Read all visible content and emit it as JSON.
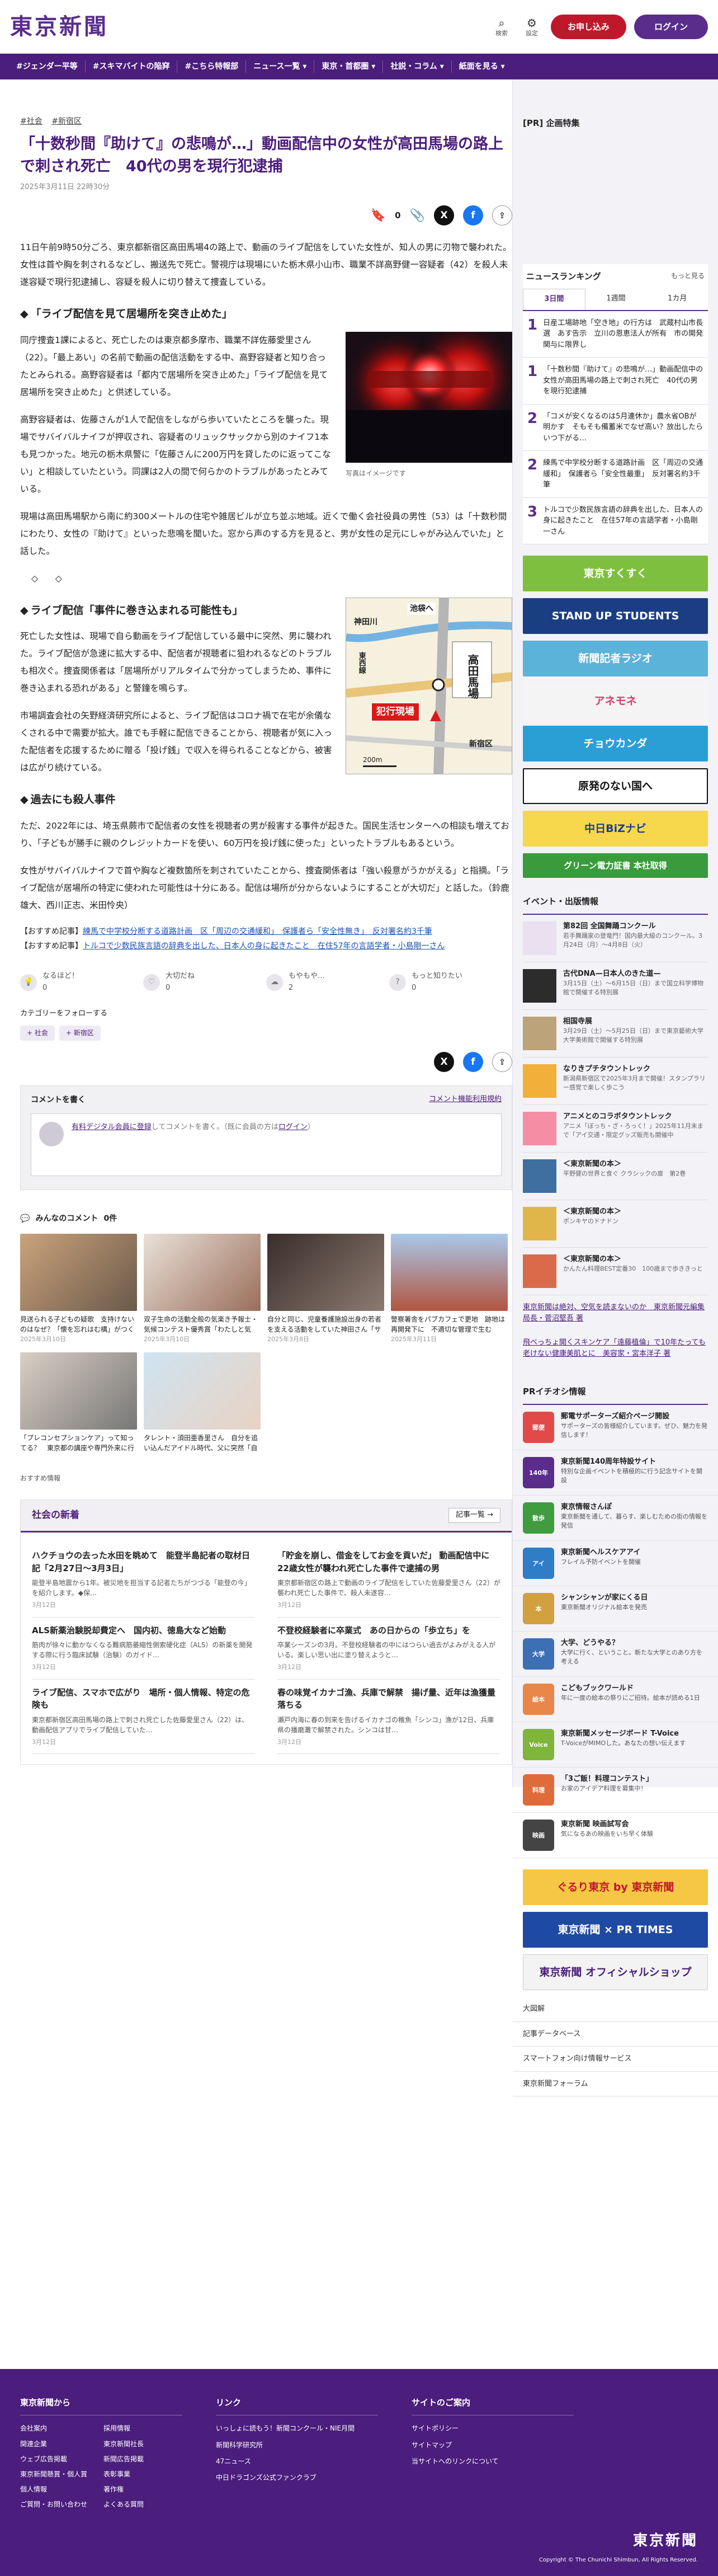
{
  "header": {
    "logo": "東京新聞",
    "search_label": "検索",
    "settings_label": "設定",
    "register_label": "お申し込み",
    "login_label": "ログイン"
  },
  "nav": [
    "#ジェンダー平等",
    "#スキマバイトの陥穽",
    "#こちら特報部",
    "ニュース一覧 ▾",
    "東京・首都圏 ▾",
    "社説・コラム ▾",
    "紙面を見る ▾"
  ],
  "article": {
    "crumbs": [
      "#社会",
      "#新宿区"
    ],
    "title": "「十数秒間『助けて』の悲鳴が…」動画配信中の女性が高田馬場の路上で刺され死亡　40代の男を現行犯逮捕",
    "date": "2025年3月11日 22時30分",
    "share_count": "0",
    "intro": "11日午前9時50分ごろ、東京都新宿区高田馬場4の路上で、動画のライブ配信をしていた女性が、知人の男に刃物で襲われた。女性は首や胸を刺されるなどし、搬送先で死亡。警視庁は現場にいた栃木県小山市、職業不詳高野健一容疑者（42）を殺人未遂容疑で現行犯逮捕し、容疑を殺人に切り替えて捜査している。",
    "h1": "「ライブ配信を見て居場所を突き止めた」",
    "p1": "同庁捜査1課によると、死亡したのは東京都多摩市、職業不詳佐藤愛里さん（22）。「最上あい」の名前で動画の配信活動をする中、高野容疑者と知り合ったとみられる。高野容疑者は「都内で居場所を突き止めた」「ライブ配信を見て居場所を突き止めた」と供述している。",
    "p2": "高野容疑者は、佐藤さんが1人で配信をしながら歩いていたところを襲った。現場でサバイバルナイフが押収され、容疑者のリュックサックから別のナイフ1本も見つかった。地元の栃木県警に「佐藤さんに200万円を貸したのに返ってこない」と相談していたという。同課は2人の間で何らかのトラブルがあったとみている。",
    "p3": "現場は高田馬場駅から南に約300メートルの住宅や雑居ビルが立ち並ぶ地域。近くで働く会社役員の男性（53）は「十数秒間にわたり、女性の『助けて』といった悲鳴を聞いた。窓から声のする方を見ると、男が女性の足元にしゃがみ込んでいた」と話した。",
    "divider": "◇　　◇",
    "h2": "ライブ配信「事件に巻き込まれる可能性も」",
    "p4": "死亡した女性は、現場で自ら動画をライブ配信している最中に突然、男に襲われた。ライブ配信が急速に拡大する中、配信者が視聴者に狙われるなどのトラブルも相次ぐ。捜査関係者は「居場所がリアルタイムで分かってしまうため、事件に巻き込まれる恐れがある」と警鐘を鳴らす。",
    "p5": "市場調査会社の矢野経済研究所によると、ライブ配信はコロナ禍で在宅が余儀なくされる中で需要が拡大。誰でも手軽に配信できることから、視聴者が気に入った配信者を応援するために贈る「投げ銭」で収入を得られることなどから、被害は広がり続けている。",
    "h3": "過去にも殺人事件",
    "p6": "ただ、2022年には、埼玉県蕨市で配信者の女性を視聴者の男が殺害する事件が起きた。国民生活センターへの相談も増えており、「子どもが勝手に親のクレジットカードを使い、60万円を投げ銭に使った」といったトラブルもあるという。",
    "p7": "女性がサバイバルナイフで首や胸など複数箇所を刺されていたことから、捜査関係者は「強い殺意がうかがえる」と指摘。「ライブ配信が居場所の特定に使われた可能性は十分にある。配信は場所が分からないようにすることが大切だ」と話した。（鈴鹿雄大、西川正志、米田怜央）",
    "photo_caption": "写真はイメージです",
    "related": [
      {
        "label": "【おすすめ記事】",
        "text": "練馬で中学校分断する道路計画　区「周辺の交通緩和」　保護者ら「安全性無き」　反対署名約3千筆"
      },
      {
        "label": "【おすすめ記事】",
        "text": "トルコで少数民族言語の辞典を出した、日本人の身に起きたこと　在住57年の言語学者・小島剛一さん"
      }
    ],
    "reactions": [
      {
        "label": "なるほど！",
        "count": "0"
      },
      {
        "label": "大切だね",
        "count": "0"
      },
      {
        "label": "もやもや…",
        "count": "2"
      },
      {
        "label": "もっと知りたい",
        "count": "0"
      }
    ],
    "follow_label": "カテゴリーをフォローする",
    "tags": [
      "+ 社会",
      "+ 新宿区"
    ]
  },
  "map": {
    "station": "高田馬場",
    "label_scene": "犯行現場",
    "label_kanda": "神田川",
    "label_ikebukuro": "池袋へ",
    "label_sanbancho": "新宿区",
    "label_line": "西武新宿線",
    "scale": "200m",
    "road1": "早稲田通り",
    "road2": "東西線"
  },
  "comments": {
    "title": "コメントを書く",
    "guide": "コメント機能利用規約",
    "prompt_link": "有料デジタル会員に登録",
    "prompt_rest": "してコメントを書く。（既に会員の方は",
    "login_link": "ログイン",
    "prompt_end": "）",
    "list_title": "みんなのコメント",
    "list_count": "0件"
  },
  "cards": [
    {
      "title": "見送られる子どもの疑歌　支持けないのはなぜ？「懐を忘れはむ構」がつくこ教員確保を小児外…",
      "date": "2025年3月10日"
    },
    {
      "title": "双子生命の活動全般の気楽き予報士・気候コンテスト優秀賞「わたしと気象」…",
      "date": "2025年3月10日"
    },
    {
      "title": "自分と同じ、児童養護施設出身の若者を支える活動をしていた神田さん「サヘル・ロー…",
      "date": "2025年3月8日"
    },
    {
      "title": "警察署舎をパブカフェで更地　跡地は再開発下に　不適切な管理で生む",
      "date": "2025年3月11日"
    },
    {
      "title": "「プレコンセプションケア」って知ってる？　東京都の講座や専門外来に行ってみた",
      "date": ""
    },
    {
      "title": "タレント・須田亜香里さん　自分を追い込んだアイドル時代、父に突然「自分のこと好き？…",
      "date": ""
    }
  ],
  "reco_label": "おすすめ情報",
  "social_news": {
    "title": "社会の新着",
    "more": "記事一覧 →",
    "items": [
      {
        "title": "ハクチョウの去った水田を眺めて　能登半島記者の取材日記「2月27日〜3月3日」",
        "snippet": "能登半島地震から1年。被災地を担当する記者たちがつづる「能登の今」を紹介します。◆保…",
        "date": "3月12日"
      },
      {
        "title": "「貯金を崩し、借金をしてお金を貢いだ」 動画配信中に22歳女性が襲われ死亡した事件で逮捕の男",
        "snippet": "東京都新宿区の路上で動画のライブ配信をしていた佐藤愛里さん（22）が襲われ死亡した事件で、殺人未遂容…",
        "date": "3月12日"
      },
      {
        "title": "ALS新薬治験脱却費定へ　国内初、徳島大など始動",
        "snippet": "筋肉が徐々に動かなくなる難病筋萎縮性側索硬化症（ALS）の新薬を開発する際に行う臨床試験（治験）のガイド…",
        "date": "3月12日"
      },
      {
        "title": "不登校経験者に卒業式　あの日からの「歩立ち」を",
        "snippet": "卒業シーズンの3月。不登校経験者の中にはつらい過去がよみがえる人がいる。楽しい思い出に塗り替えようと…",
        "date": "3月12日"
      },
      {
        "title": "ライブ配信、スマホで広がり　場所・個人情報、特定の危険も",
        "snippet": "東京都新宿区高田馬場の路上で刺され死亡した佐藤愛里さん（22）は、動画配信アプリでライブ配信していた…",
        "date": "3月12日"
      },
      {
        "title": "春の味覚イカナゴ漁、兵庫で解禁　揚げ量、近年は漁獲量落ちる",
        "snippet": "瀬戸内海に春の到来を告げるイカナゴの稚魚「シンコ」漁が12日、兵庫県の播磨灘で解禁された。シンコは甘…",
        "date": "3月12日"
      }
    ]
  },
  "sidebar": {
    "pr_title": "[PR] 企画特集",
    "ranking_title": "ニュースランキング",
    "ranking_more": "もっと見る",
    "ranking_tabs": [
      "3日間",
      "1週間",
      "1カ月"
    ],
    "ranking": [
      {
        "n": "1",
        "text": "日産工場跡地「空き地」の行方は　武蔵村山市長選　あす告示　立川の恩恵法人が所有　市の開発関与に限界し"
      },
      {
        "n": "1",
        "text": "「十数秒間『助けて』の悲鳴が…」動画配信中の女性が高田馬場の路上で刺され死亡　40代の男を現行犯逮捕"
      },
      {
        "n": "2",
        "text": "「コメが安くなるのは5月連休か」農水省OBが明かす　そもそも備蓄米でなぜ高い？放出したらいつ下がる…"
      },
      {
        "n": "2",
        "text": "練馬で中学校分断する道路計画　区「周辺の交通緩和」　保護者ら「安全性最重」　反対署名約3千筆"
      },
      {
        "n": "3",
        "text": "トルコで少数民族言語の辞典を出した、日本人の身に起きたこと　在住57年の言語学者・小島剛一さん"
      }
    ],
    "banners": [
      {
        "label": "東京すくすく",
        "bg": "#7fbf3f"
      },
      {
        "label": "STAND UP STUDENTS",
        "bg": "#1b3e83"
      },
      {
        "label": "新聞記者ラジオ",
        "bg": "#5cb3d9"
      },
      {
        "label": "アネモネ",
        "bg": "#f4f4f4"
      },
      {
        "label": "チョウカンダ",
        "bg": "#2a9fd6"
      },
      {
        "label": "原発のない国へ",
        "bg": "#ffffff"
      },
      {
        "label": "中日BiZナビ",
        "bg": "#f7d74c"
      },
      {
        "label": "グリーン電力証書 本社取得",
        "bg": "#3a9b3c"
      }
    ],
    "events_title": "イベント・出版情報",
    "events": [
      {
        "title": "第82回 全国舞踊コンクール",
        "desc": "若手舞踊家の登竜門！国内最大級のコンクール。3月24日（月）〜4月8日（火）"
      },
      {
        "title": "古代DNA—日本人のきた道—",
        "desc": "3月15日（土）〜6月15日（日）まで国立科学博物館で開催する特別展"
      },
      {
        "title": "相国寺展",
        "desc": "3月29日（土）〜5月25日（日）まで東京藝術大学大学美術館で開催する特別展"
      },
      {
        "title": "なりきプチタウントレック",
        "desc": "新潟県新宿区で2025年3月まで開催！スタンプラリー感覚で楽しく歩こう"
      },
      {
        "title": "アニメとのコラボタウントレック",
        "desc": "アニメ「ぼっち・ざ・ろっく！」2025年11月末まで「アイ交通・限定グッズ販売も開催中"
      },
      {
        "title": "＜東京新聞の本＞",
        "desc": "平野健の世界と食ぐ クラシックの扉　第2巻"
      },
      {
        "title": "＜東京新聞の本＞",
        "desc": "ポンキヤのドナドン"
      },
      {
        "title": "＜東京新聞の本＞",
        "desc": "かんたん料理BEST定番30　100歳まで歩ききっと"
      }
    ],
    "side_links": [
      "東京新聞は絶対、空気を読まないのか　東京新聞元編集局長・菅沼堅吾 著",
      "飛べっちょ開くスキンケア「遠藤植倫」で10年たっても老けない健康美肌とに　美容家・宮本洋子 著"
    ],
    "pr_info_title": "PRイチオシ情報",
    "pr_info": [
      {
        "icon": "郵便",
        "title": "郵電サポーターズ紹介ページ開設",
        "desc": "サポーターズの皆様紹介しています。ぜひ、魅力を発信します！",
        "bg": "#e24a4a"
      },
      {
        "icon": "140年",
        "title": "東京新聞140周年特設サイト",
        "desc": "特別な企画イベントを積極的に行う記念サイトを開設",
        "bg": "#5a2d8c"
      },
      {
        "icon": "散歩",
        "title": "東京情報さんぽ",
        "desc": "東京新聞を通して、暮らす、楽しむための街の情報を発信",
        "bg": "#3f9c3f"
      },
      {
        "icon": "アイ",
        "title": "東京新聞ヘルスケアアイ",
        "desc": "フレイル予防イベントを開催",
        "bg": "#2f7cc7"
      },
      {
        "icon": "本",
        "title": "シャンシャンが家にくる日",
        "desc": "東京新聞オリジナル絵本を発売",
        "bg": "#d2a03f"
      },
      {
        "icon": "大学",
        "title": "大学、どうやる？",
        "desc": "大学に行く、ということ。新たな大学とのあり方を考える",
        "bg": "#3d6fb5"
      },
      {
        "icon": "絵本",
        "title": "こどもブックワールド",
        "desc": "年に一度の絵本の祭りにご招待。絵本が読める1日",
        "bg": "#e9864a"
      },
      {
        "icon": "Voice",
        "title": "東京新聞メッセージボード T-Voice",
        "desc": "T-VoiceがMIMOした。あなたの想い伝えます",
        "bg": "#7fb53b"
      },
      {
        "icon": "料理",
        "title": "「3ご飯！料理コンテスト」",
        "desc": "お家のアイデア料理を募集中！",
        "bg": "#e06b3a"
      },
      {
        "icon": "映画",
        "title": "東京新聞 映画試写会",
        "desc": "気になるあの映画をいち早く体験",
        "bg": "#444444"
      }
    ],
    "big_banners": [
      {
        "label": "ぐるり東京 by 東京新聞",
        "bg": "#f6c744"
      },
      {
        "label": "東京新聞 × PR TIMES",
        "bg": "#1f4aa3"
      },
      {
        "label": "東京新聞 オフィシャルショップ",
        "bg": "#f3f3f3"
      }
    ],
    "bottom_links": [
      "大図解",
      "記事データベース",
      "スマートフォン向け情報サービス",
      "東京新聞フォーラム"
    ]
  },
  "footer": {
    "col1_title": "東京新聞から",
    "col1": [
      "会社案内",
      "採用情報",
      "関連企業",
      "東京新聞社長",
      "ウェブ広告掲載",
      "新聞広告掲載",
      "東京新聞懸賞・個人賞",
      "表彰事業",
      "個人情報",
      "著作権",
      "ご質問・お問い合わせ",
      "よくある質問"
    ],
    "col2_title": "リンク",
    "col2": [
      "いっしょに読もう！新聞コンクール・NIE月間",
      "新聞科学研究所",
      "47ニュース",
      "中日ドラゴンズ公式ファンクラブ"
    ],
    "col3_title": "サイトのご案内",
    "col3": [
      "サイトポリシー",
      "サイトマップ",
      "当サイトへのリンクについて"
    ],
    "logo": "東京新聞",
    "copyright": "Copyright © The Chunichi Shimbun, All Rights Reserved."
  }
}
